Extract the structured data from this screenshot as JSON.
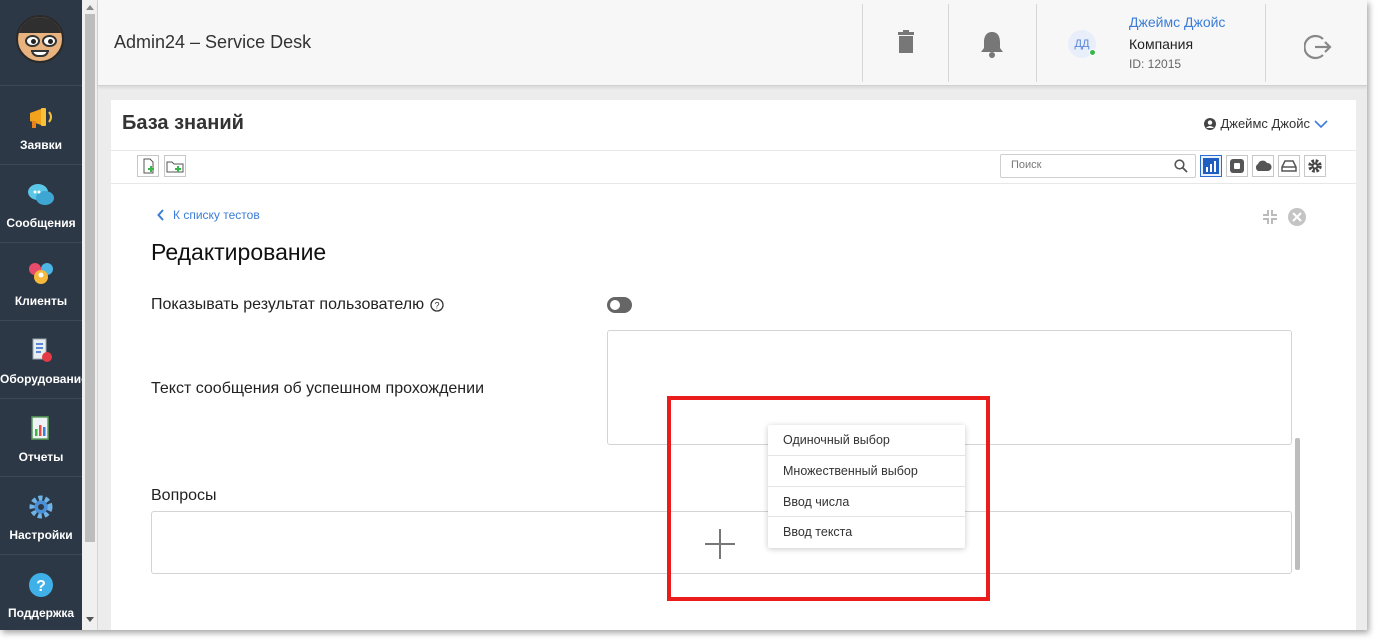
{
  "app": {
    "title": "Admin24 – Service Desk"
  },
  "sidebar": {
    "items": [
      {
        "label": "Заявки",
        "icon": "megaphone-icon"
      },
      {
        "label": "Сообщения",
        "icon": "chat-bubbles-icon"
      },
      {
        "label": "Клиенты",
        "icon": "clients-icon"
      },
      {
        "label": "Оборудование",
        "icon": "equipment-icon"
      },
      {
        "label": "Отчеты",
        "icon": "report-chart-icon"
      },
      {
        "label": "Настройки",
        "icon": "gear-icon"
      },
      {
        "label": "Поддержка",
        "icon": "question-icon"
      }
    ]
  },
  "topbar": {
    "user": {
      "initials": "ДД",
      "name": "Джеймс Джойс",
      "company": "Компания",
      "id": "ID: 12015"
    }
  },
  "page": {
    "title": "База знаний",
    "user_label": "Джеймс Джойс",
    "search_placeholder": "Поиск",
    "back_link": "К списку тестов",
    "heading": "Редактирование",
    "show_result_label": "Показывать результат пользователю",
    "success_text_label": "Текст сообщения об успешном прохождении",
    "questions_label": "Вопросы",
    "show_result_enabled": false
  },
  "question_type_menu": {
    "items": [
      "Одиночный выбор",
      "Множественный выбор",
      "Ввод числа",
      "Ввод текста"
    ]
  },
  "colors": {
    "sidebar": "#2c3845",
    "accent": "#3b7dd8",
    "highlight": "#ea1c1c",
    "online": "#3ab54a"
  }
}
